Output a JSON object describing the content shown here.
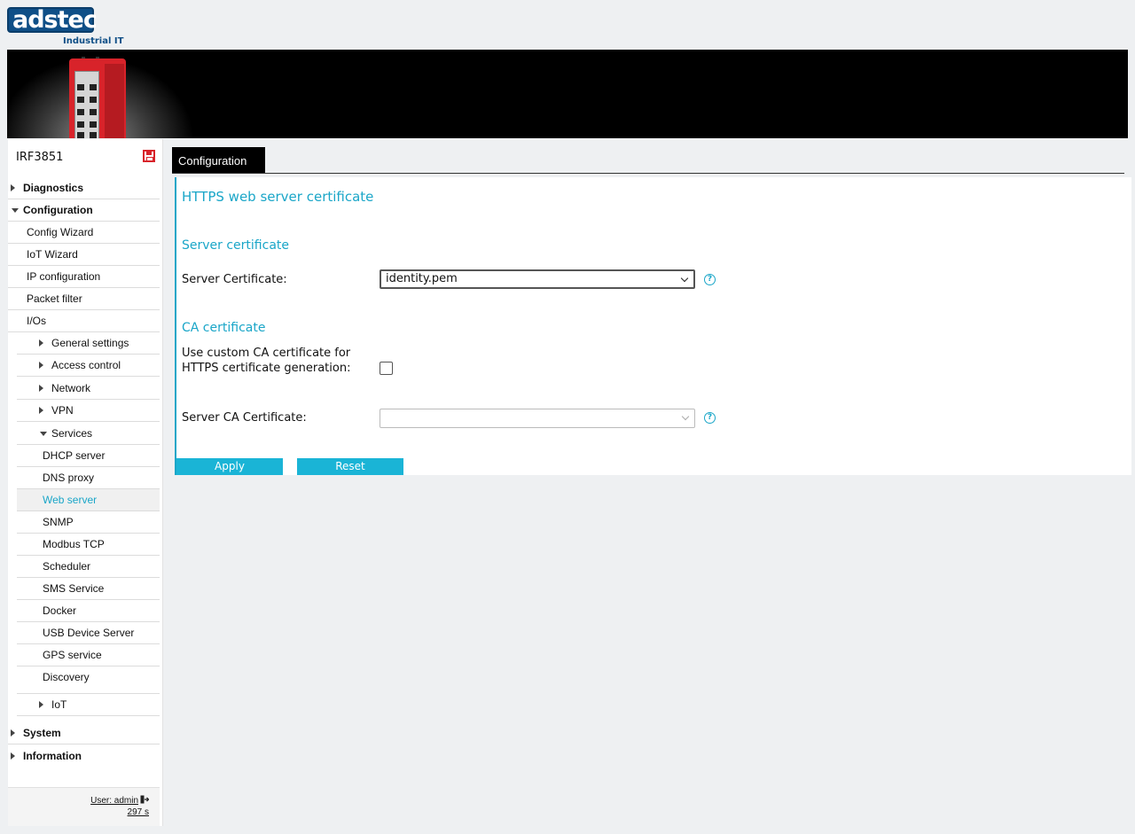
{
  "logo": {
    "brand": "adstec",
    "tagline": "Industrial IT"
  },
  "sidebar": {
    "device_name": "IRF3851",
    "items": [
      {
        "label": "Diagnostics"
      },
      {
        "label": "Configuration"
      },
      {
        "label": "Config Wizard"
      },
      {
        "label": "IoT Wizard"
      },
      {
        "label": "IP configuration"
      },
      {
        "label": "Packet filter"
      },
      {
        "label": "I/Os"
      },
      {
        "label": "General settings"
      },
      {
        "label": "Access control"
      },
      {
        "label": "Network"
      },
      {
        "label": "VPN"
      },
      {
        "label": "Services"
      },
      {
        "label": "DHCP server"
      },
      {
        "label": "DNS proxy"
      },
      {
        "label": "Web server"
      },
      {
        "label": "SNMP"
      },
      {
        "label": "Modbus TCP"
      },
      {
        "label": "Scheduler"
      },
      {
        "label": "SMS Service"
      },
      {
        "label": "Docker"
      },
      {
        "label": "USB Device Server"
      },
      {
        "label": "GPS service"
      },
      {
        "label": "Discovery"
      },
      {
        "label": "IoT"
      },
      {
        "label": "System"
      },
      {
        "label": "Information"
      }
    ],
    "user": "User: admin",
    "session": "297 s"
  },
  "main": {
    "tab": "Configuration",
    "title": "HTTPS web server certificate",
    "server_section": "Server certificate",
    "server_cert_label": "Server Certificate:",
    "server_cert_value": "identity.pem",
    "ca_section": "CA certificate",
    "custom_ca_label": "Use custom CA certificate for HTTPS certificate generation:",
    "custom_ca_checked": false,
    "server_ca_label": "Server CA Certificate:",
    "server_ca_value": "",
    "help_glyph": "?",
    "apply": "Apply",
    "reset": "Reset"
  },
  "colors": {
    "accent": "#1aa6c8",
    "button": "#1ab4d6",
    "brand": "#0f4f87",
    "device_red": "#d8232a"
  }
}
